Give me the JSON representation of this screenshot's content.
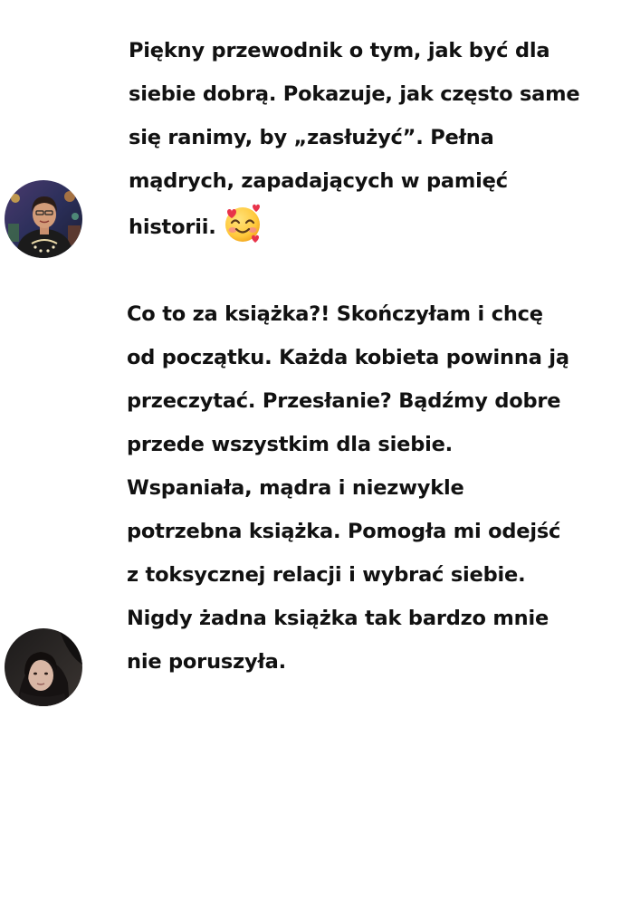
{
  "reviews": [
    {
      "avatar_icon": "woman-portrait-avatar-icon",
      "text": "Piękny przewodnik o tym, jak być dla\nsiebie dobrą. Pokazuje, jak często same\nsię ranimy, by „zasłużyć”. Pełna\nmądrych, zapadających w pamięć\nhistorii.",
      "emoji": "smiling-face-with-hearts-icon"
    },
    {
      "avatar_icon": "girl-portrait-avatar-icon",
      "text": "Co to za książka?! Skończyłam i chcę\nod początku. Każda kobieta powinna ją\nprzeczytać. Przesłanie? Bądźmy dobre\nprzede wszystkim dla siebie.\nWspaniała, mądra i niezwykle\npotrzebna książka. Pomogła mi odejść\nz toksycznej relacji i wybrać siebie.\nNigdy żadna książka tak bardzo mnie\nnie poruszyła."
    }
  ]
}
